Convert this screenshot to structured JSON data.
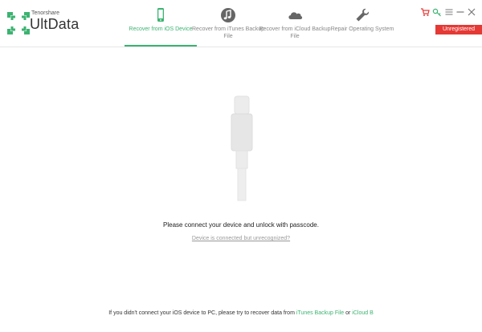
{
  "brand": {
    "company": "Tenorshare",
    "product": "UltData"
  },
  "tabs": [
    {
      "label": "Recover from iOS Device",
      "icon": "phone-icon",
      "active": true
    },
    {
      "label": "Recover from iTunes Backup File",
      "icon": "music-note-icon",
      "active": false
    },
    {
      "label": "Recover from iCloud Backup File",
      "icon": "cloud-icon",
      "active": false
    },
    {
      "label": "Repair Operating System",
      "icon": "wrench-icon",
      "active": false
    }
  ],
  "window_controls": [
    "cart-icon",
    "key-icon",
    "menu-icon",
    "minimize-icon",
    "close-icon"
  ],
  "badge": "Unregistered",
  "main": {
    "message": "Please connect your device and unlock with passcode.",
    "unrecognized_link": "Device is connected but unrecognized?"
  },
  "footer": {
    "text": "If you didn't connect your iOS device to PC, please try to recover data from",
    "itunes_link": "iTunes Backup File",
    "or": "or",
    "icloud_link": "iCloud B"
  },
  "colors": {
    "accent": "#3cb371",
    "badge": "#e53935",
    "icon_gray": "#666666"
  }
}
